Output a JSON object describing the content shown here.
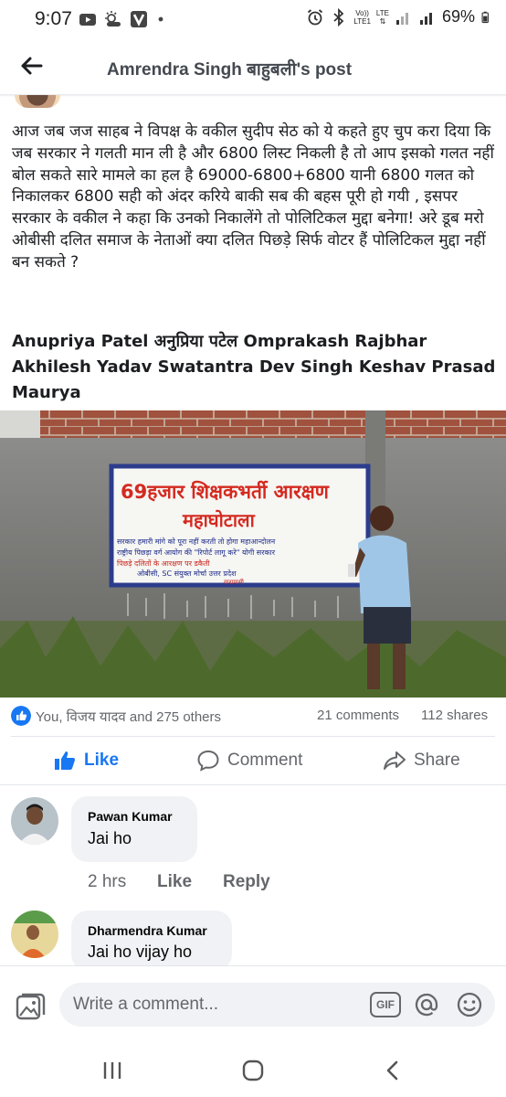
{
  "status_bar": {
    "time": "9:07",
    "left_icons": [
      "youtube-icon",
      "weather-icon",
      "app-v-icon",
      "dot-icon"
    ],
    "right_icons": [
      "alarm-icon",
      "bluetooth-icon",
      "volte-icon",
      "lte-icon",
      "signal-icon",
      "signal-icon-2",
      "battery-icon"
    ],
    "volte_label": "Vo))",
    "lte_label": "LTE",
    "lte1_label": "LTE1",
    "battery": "69%"
  },
  "header": {
    "title": "Amrendra Singh बाहुबली's post"
  },
  "post": {
    "text": "आज जब जज साहब ने विपक्ष के वकील सुदीप सेठ को ये कहते हुए चुप करा दिया कि जब सरकार ने गलती मान ली है और 6800 लिस्ट निकली है तो आप इसको गलत नहीं बोल सकते सारे मामले का हल है 69000-6800+6800 यानी 6800 गलत को निकालकर 6800 सही को अंदर करिये बाकी सब की बहस पूरी हो गयी , इसपर सरकार के वकील ने कहा कि उनको निकालेंगे तो पोलिटिकल मुद्दा बनेगा! अरे डूब मरो ओबीसी दलित समाज के नेताओं क्या दलित पिछड़े सिर्फ वोटर हैं पोलिटिकल मुद्दा नहीं बन सकते ?",
    "tags": "Anupriya Patel अनुप्रिया पटेल Omprakash Rajbhar Akhilesh Yadav Swatantra Dev Singh Keshav Prasad Maurya"
  },
  "banner": {
    "line1": "69हजार शिक्षकभर्ती आरक्षण",
    "line2": "महाघोटाला",
    "line3": "सरकार हमारी मांगे को पूरा नहीं करती तो होगा महाआन्दोलन",
    "line4": "राष्ट्रीय पिछड़ा वर्ग आयोग की \"रिपोर्ट लागू करे\" योगी सरकार",
    "line5": "पिछड़े दलितों के आरक्षण पर डकैती",
    "line6": "ओबीसी, SC संयुक्त मोर्चा उत्तर प्रदेश",
    "line7": "वाराणसी"
  },
  "reactions": {
    "summary": "You, विजय यादव and 275 others",
    "comments": "21 comments",
    "shares": "112 shares"
  },
  "actions": {
    "like": "Like",
    "comment": "Comment",
    "share": "Share"
  },
  "comments": [
    {
      "name": "Pawan Kumar",
      "text": "Jai ho",
      "time": "2 hrs",
      "like": "Like",
      "reply": "Reply"
    },
    {
      "name": "Dharmendra Kumar",
      "text": "Jai ho vijay ho"
    }
  ],
  "composer": {
    "placeholder": "Write a comment...",
    "gif": "GIF"
  },
  "nav": [
    "recents-icon",
    "home-icon",
    "back-icon"
  ],
  "colors": {
    "accent": "#1877f2",
    "secondary_text": "#65676b",
    "bubble": "#f0f2f5"
  }
}
